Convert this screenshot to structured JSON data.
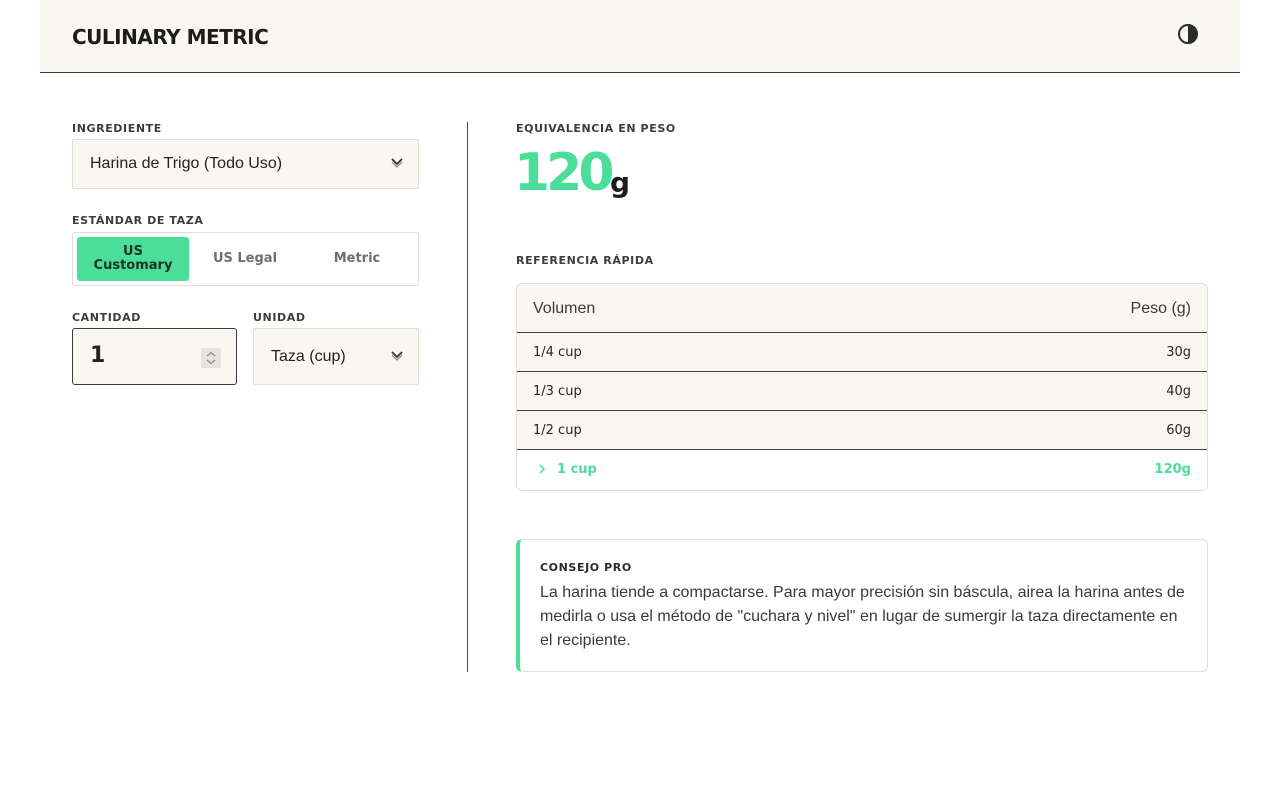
{
  "header": {
    "brand": "CULINARY METRIC",
    "theme_icon": "contrast-icon"
  },
  "form": {
    "ingredient_label": "INGREDIENTE",
    "ingredient_value": "Harina de Trigo (Todo Uso)",
    "cup_standard_label": "ESTÁNDAR DE TAZA",
    "cup_standards": [
      {
        "label": "US\nCustomary",
        "active": true
      },
      {
        "label": "US Legal",
        "active": false
      },
      {
        "label": "Metric",
        "active": false
      }
    ],
    "quantity_label": "CANTIDAD",
    "quantity_value": "1",
    "unit_label": "UNIDAD",
    "unit_value": "Taza (cup)"
  },
  "result": {
    "label": "EQUIVALENCIA EN PESO",
    "value": "120",
    "unit": "g"
  },
  "reference": {
    "label": "REFERENCIA RÁPIDA",
    "columns": [
      "Volumen",
      "Peso (g)"
    ],
    "rows": [
      {
        "volume": "1/4 cup",
        "weight": "30g",
        "highlight": false
      },
      {
        "volume": "1/3 cup",
        "weight": "40g",
        "highlight": false
      },
      {
        "volume": "1/2 cup",
        "weight": "60g",
        "highlight": false
      },
      {
        "volume": "1 cup",
        "weight": "120g",
        "highlight": true
      }
    ]
  },
  "tip": {
    "label": "CONSEJO PRO",
    "text": "La harina tiende a compactarse. Para mayor precisión sin báscula, airea la harina antes de medirla o usa el método de \"cuchara y nivel\" en lugar de sumergir la taza directamente en el recipiente."
  },
  "colors": {
    "accent": "#4ade98",
    "surface": "#faf7f3",
    "text": "#1f1f1f"
  }
}
